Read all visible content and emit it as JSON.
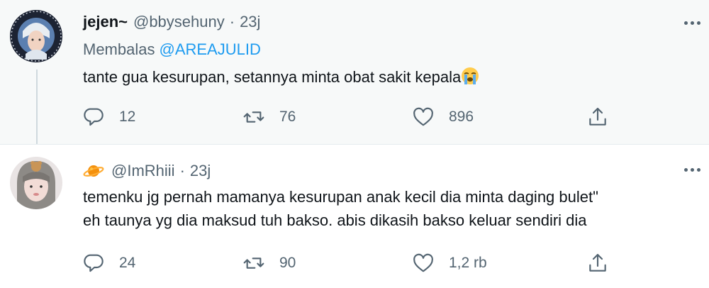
{
  "colors": {
    "text": "#0f1419",
    "secondary": "#536471",
    "link": "#1d9bf0",
    "highlight_bg": "#f7f9f9",
    "divider": "#e6ecf0"
  },
  "tweets": [
    {
      "display_name": "jejen~",
      "handle": "@bbysehuny",
      "dot": "·",
      "time": "23j",
      "reply_label": "Membalas",
      "reply_mention": "@AREAJULID",
      "text": "tante gua kesurupan, setannya minta obat sakit kepala",
      "emoji_icon": "loudly-crying-face-icon",
      "reply_count": "12",
      "retweet_count": "76",
      "like_count": "896"
    },
    {
      "display_name_icon": "ringed-planet-icon",
      "handle": "@ImRhiii",
      "dot": "·",
      "time": "23j",
      "text_line1": "temenku jg pernah mamanya kesurupan anak kecil dia minta daging bulet\"",
      "text_line2": "eh taunya yg dia maksud tuh bakso. abis dikasih bakso keluar sendiri dia",
      "reply_count": "24",
      "retweet_count": "90",
      "like_count": "1,2 rb"
    }
  ]
}
